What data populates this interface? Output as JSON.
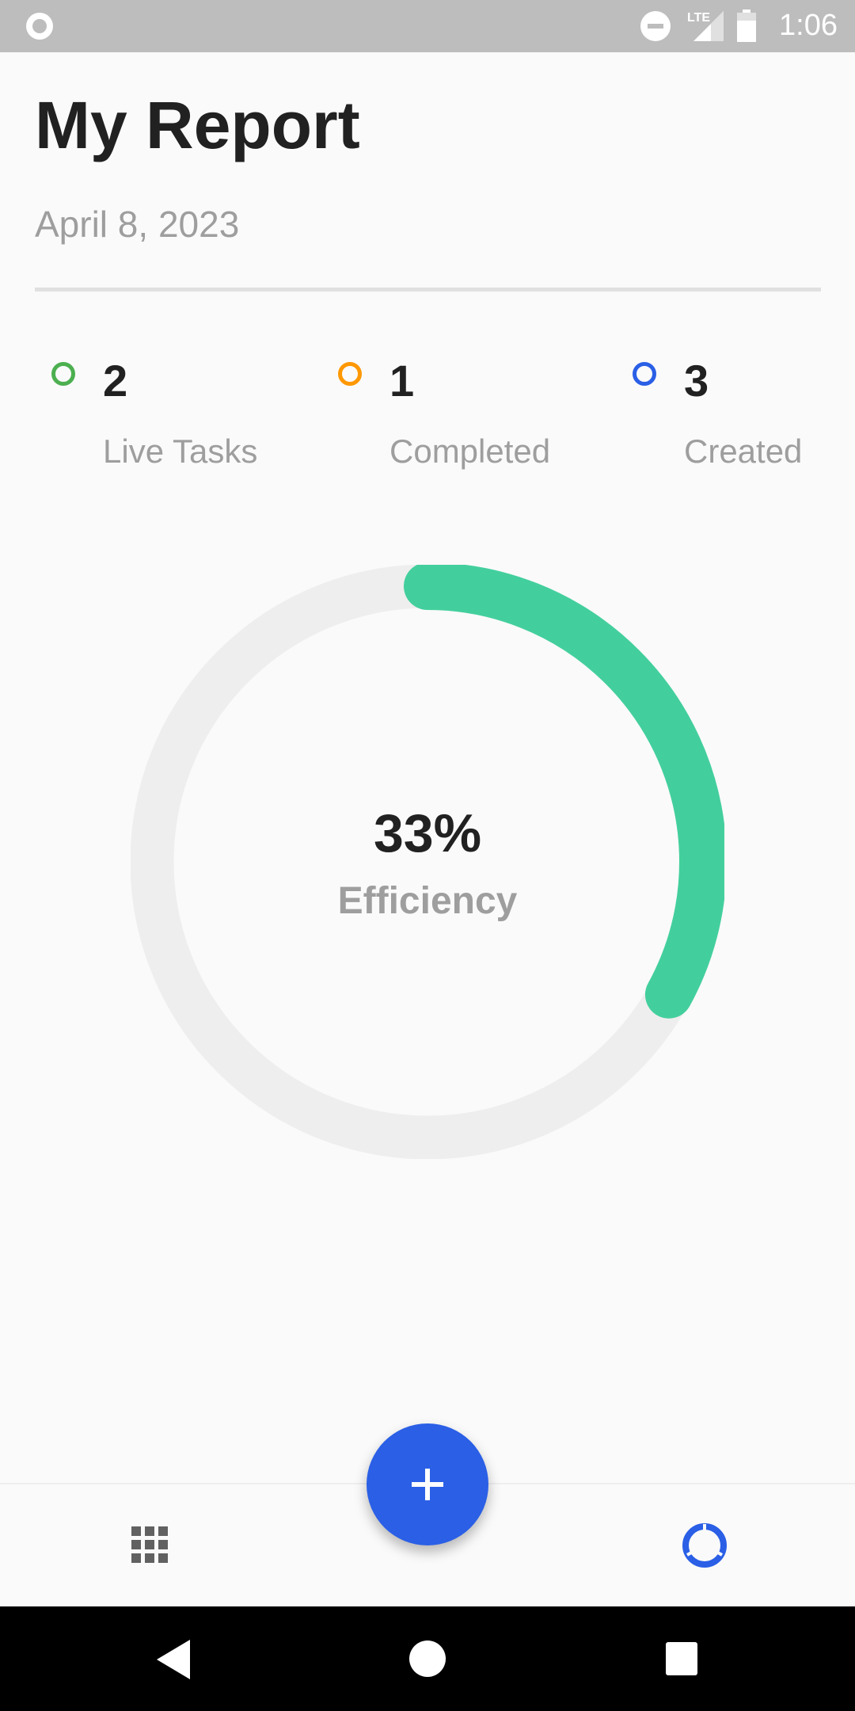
{
  "status_bar": {
    "time": "1:06",
    "network": "LTE",
    "icons": [
      "record-icon",
      "do-not-disturb-icon",
      "lte-signal-icon",
      "battery-icon"
    ]
  },
  "header": {
    "title": "My Report",
    "date": "April 8, 2023"
  },
  "stats": [
    {
      "value": "2",
      "label": "Live Tasks",
      "color": "#4caf50"
    },
    {
      "value": "1",
      "label": "Completed",
      "color": "#ff9800"
    },
    {
      "value": "3",
      "label": "Created",
      "color": "#2a5fe6"
    }
  ],
  "efficiency": {
    "value_text": "33%",
    "label": "Efficiency",
    "fraction": 0.33,
    "progress_color": "#43cf9d",
    "track_color": "#eeeeee"
  },
  "bottom_nav": {
    "items": [
      {
        "icon": "grid-icon",
        "color": "#616161"
      },
      {
        "icon": "report-ring-icon",
        "color": "#2a5fe6"
      }
    ],
    "fab": {
      "icon": "plus-icon",
      "color": "#2a5fe6"
    }
  },
  "system_nav": {
    "icons": [
      "back-icon",
      "home-icon",
      "recents-icon"
    ]
  }
}
